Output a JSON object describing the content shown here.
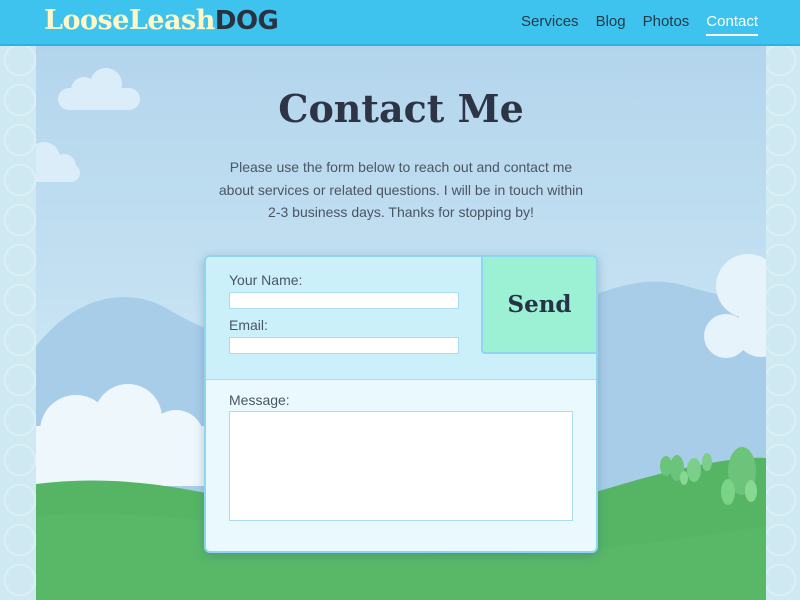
{
  "header": {
    "logo_main": "LooseLeash",
    "logo_accent": "DOG",
    "nav": [
      "Services",
      "Blog",
      "Photos",
      "Contact"
    ],
    "active_nav": "Contact"
  },
  "main": {
    "title": "Contact Me",
    "intro": "Please use the form below to reach out and contact me about services or related questions. I will be in touch within 2-3 business days. Thanks for stopping by!"
  },
  "form": {
    "name_label": "Your Name:",
    "name_value": "",
    "email_label": "Email:",
    "email_value": "",
    "message_label": "Message:",
    "message_value": "",
    "send_label": "Send"
  },
  "colors": {
    "header": "#3ec3ee",
    "logo_main": "#fff7c8",
    "logo_accent": "#2a3140",
    "send_button": "#9cf0d3",
    "grass": "#56b565"
  }
}
